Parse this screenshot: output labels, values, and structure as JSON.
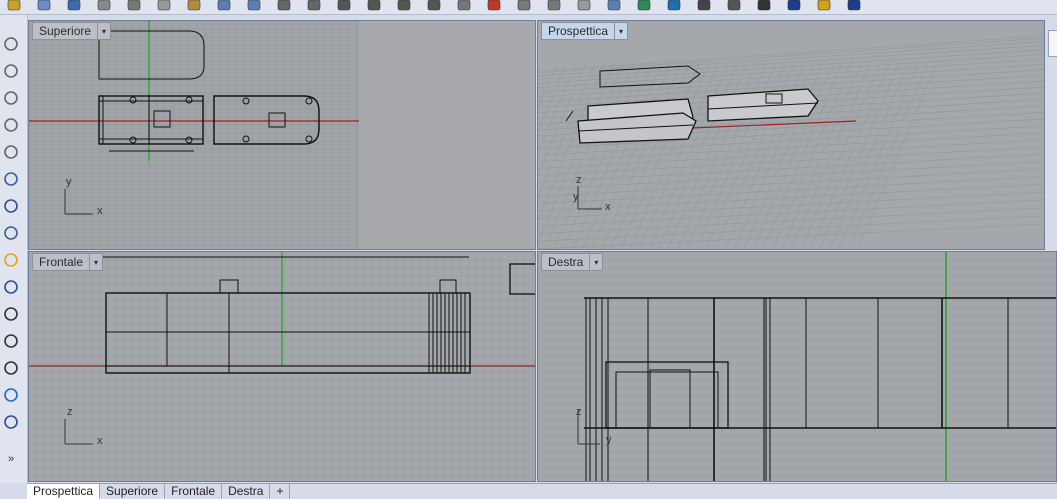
{
  "toolbar": {
    "icons": [
      "new-icon",
      "open-icon",
      "save-icon",
      "print-icon",
      "cut-icon",
      "copy-icon",
      "paste-icon",
      "undo-icon",
      "redo-icon",
      "pan-icon",
      "rotate-view-icon",
      "zoom-icon",
      "zoom-window-icon",
      "zoom-extents-icon",
      "zoom-selected-icon",
      "viewport-icon",
      "layer-icon",
      "properties-icon",
      "select-icon",
      "grid-icon",
      "osnap-icon",
      "render-icon",
      "material-icon",
      "sphere-icon",
      "shade-icon",
      "ghost-icon",
      "light-icon",
      "options-icon",
      "help-icon"
    ]
  },
  "sidebar": {
    "icons": [
      "point-icon",
      "curve-icon",
      "circle-icon",
      "rectangle-icon",
      "arc-icon",
      "surface-icon",
      "sphere-solid-icon",
      "mesh-icon",
      "fillet-icon",
      "boolean-icon",
      "transform-icon",
      "rotate-icon",
      "scale-icon",
      "snap-icon",
      "dimension-icon",
      "more-icon"
    ],
    "more_label": "»"
  },
  "viewports": {
    "top": {
      "title": "Superiore",
      "axis_y": "y",
      "axis_x": "x"
    },
    "perspective": {
      "title": "Prospettica",
      "axis_y": "z",
      "axis_x": "x",
      "axis_y2": "y"
    },
    "front": {
      "title": "Frontale",
      "axis_y": "z",
      "axis_x": "x"
    },
    "right": {
      "title": "Destra",
      "axis_y": "z",
      "axis_x": "y"
    },
    "dropdown_glyph": "▾"
  },
  "tabs": [
    "Prospettica",
    "Superiore",
    "Frontale",
    "Destra"
  ],
  "active_tab": "Prospettica",
  "add_tab_label": "+"
}
